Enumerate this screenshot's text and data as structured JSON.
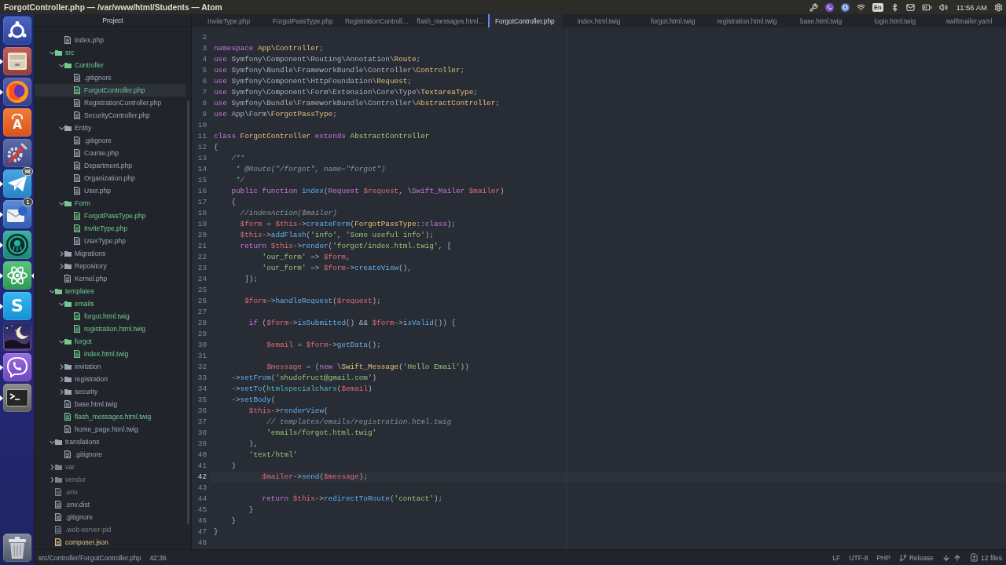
{
  "window": {
    "title": "ForgotController.php — /var/www/html/Students — Atom"
  },
  "top_bar": {
    "keyboard_layout": "En",
    "clock": "11:56 AM"
  },
  "launcher": {
    "items": [
      {
        "kind": "dash",
        "running": false,
        "focused": false
      },
      {
        "kind": "files",
        "running": true,
        "focused": false
      },
      {
        "kind": "browser",
        "running": true,
        "focused": false
      },
      {
        "kind": "store",
        "glyph": "A",
        "running": false,
        "focused": false
      },
      {
        "kind": "tools",
        "running": false,
        "focused": false
      },
      {
        "kind": "messenger",
        "badge": "98",
        "running": true,
        "focused": false
      },
      {
        "kind": "mail",
        "badge": "1",
        "running": true,
        "focused": false
      },
      {
        "kind": "octopus",
        "running": true,
        "focused": false
      },
      {
        "kind": "atom",
        "running": true,
        "focused": true
      },
      {
        "kind": "chat",
        "glyph": "S",
        "running": true,
        "focused": false
      },
      {
        "kind": "night",
        "running": false,
        "focused": false
      },
      {
        "kind": "phone",
        "running": true,
        "focused": false
      },
      {
        "kind": "terminal",
        "running": true,
        "focused": false
      }
    ],
    "bottom_items": [
      {
        "kind": "trash",
        "running": false,
        "focused": false
      }
    ]
  },
  "tree": {
    "header": "Project",
    "continued_items": [
      {
        "kind": "file",
        "name": "index.php",
        "color": "#9da5b4",
        "selected": false
      }
    ],
    "items": [
      {
        "kind": "folder",
        "name": "src",
        "color": "#73c990",
        "expanded": true,
        "selected": false,
        "children": [
          {
            "kind": "folder",
            "name": "Controller",
            "color": "#73c990",
            "expanded": true,
            "selected": false,
            "children": [
              {
                "kind": "file",
                "name": ".gitignore",
                "color": "#9da5b4",
                "selected": false
              },
              {
                "kind": "file",
                "name": "ForgotController.php",
                "color": "#73c990",
                "selected": true
              },
              {
                "kind": "file",
                "name": "RegistrationController.php",
                "color": "#9da5b4",
                "selected": false
              },
              {
                "kind": "file",
                "name": "SecurityController.php",
                "color": "#9da5b4",
                "selected": false
              }
            ]
          },
          {
            "kind": "folder",
            "name": "Entity",
            "color": "#9da5b4",
            "expanded": true,
            "selected": false,
            "children": [
              {
                "kind": "file",
                "name": ".gitignore",
                "color": "#9da5b4",
                "selected": false
              },
              {
                "kind": "file",
                "name": "Course.php",
                "color": "#9da5b4",
                "selected": false
              },
              {
                "kind": "file",
                "name": "Department.php",
                "color": "#9da5b4",
                "selected": false
              },
              {
                "kind": "file",
                "name": "Organization.php",
                "color": "#9da5b4",
                "selected": false
              },
              {
                "kind": "file",
                "name": "User.php",
                "color": "#9da5b4",
                "selected": false
              }
            ]
          },
          {
            "kind": "folder",
            "name": "Form",
            "color": "#73c990",
            "expanded": true,
            "selected": false,
            "children": [
              {
                "kind": "file",
                "name": "ForgotPassType.php",
                "color": "#73c990",
                "selected": false
              },
              {
                "kind": "file",
                "name": "InviteType.php",
                "color": "#73c990",
                "selected": false
              },
              {
                "kind": "file",
                "name": "UserType.php",
                "color": "#9da5b4",
                "selected": false
              }
            ]
          },
          {
            "kind": "folder",
            "name": "Migrations",
            "color": "#9da5b4",
            "expanded": false,
            "selected": false
          },
          {
            "kind": "folder",
            "name": "Repository",
            "color": "#9da5b4",
            "expanded": false,
            "selected": false
          },
          {
            "kind": "file",
            "name": "Kernel.php",
            "color": "#9da5b4",
            "selected": false
          }
        ]
      },
      {
        "kind": "folder",
        "name": "templates",
        "color": "#73c990",
        "expanded": true,
        "selected": false,
        "children": [
          {
            "kind": "folder",
            "name": "emails",
            "color": "#73c990",
            "expanded": true,
            "selected": false,
            "children": [
              {
                "kind": "file",
                "name": "forgot.html.twig",
                "color": "#73c990",
                "selected": false
              },
              {
                "kind": "file",
                "name": "registration.html.twig",
                "color": "#73c990",
                "selected": false
              }
            ]
          },
          {
            "kind": "folder",
            "name": "forgot",
            "color": "#73c990",
            "expanded": true,
            "selected": false,
            "children": [
              {
                "kind": "file",
                "name": "index.html.twig",
                "color": "#73c990",
                "selected": false
              }
            ]
          },
          {
            "kind": "folder",
            "name": "invitation",
            "color": "#9da5b4",
            "expanded": false,
            "selected": false
          },
          {
            "kind": "folder",
            "name": "registration",
            "color": "#9da5b4",
            "expanded": false,
            "selected": false
          },
          {
            "kind": "folder",
            "name": "security",
            "color": "#9da5b4",
            "expanded": false,
            "selected": false
          },
          {
            "kind": "file",
            "name": "base.html.twig",
            "color": "#9da5b4",
            "selected": false
          },
          {
            "kind": "file",
            "name": "flash_messages.html.twig",
            "color": "#73c990",
            "selected": false
          },
          {
            "kind": "file",
            "name": "home_page.html.twig",
            "color": "#9da5b4",
            "selected": false
          }
        ]
      },
      {
        "kind": "folder",
        "name": "translations",
        "color": "#9da5b4",
        "expanded": true,
        "selected": false,
        "children": [
          {
            "kind": "file",
            "name": ".gitignore",
            "color": "#9da5b4",
            "selected": false
          }
        ]
      },
      {
        "kind": "folder",
        "name": "var",
        "color": "#7a808c",
        "expanded": false,
        "selected": false
      },
      {
        "kind": "folder",
        "name": "vendor",
        "color": "#7a808c",
        "expanded": false,
        "selected": false
      },
      {
        "kind": "file",
        "name": ".env",
        "color": "#7a808c",
        "selected": false
      },
      {
        "kind": "file",
        "name": ".env.dist",
        "color": "#9da5b4",
        "selected": false
      },
      {
        "kind": "file",
        "name": ".gitignore",
        "color": "#9da5b4",
        "selected": false
      },
      {
        "kind": "file",
        "name": ".web-server-pid",
        "color": "#7a808c",
        "selected": false
      },
      {
        "kind": "file",
        "name": "composer.json",
        "color": "#e2c08d",
        "selected": false
      }
    ]
  },
  "tabs": [
    {
      "label": "InviteType.php",
      "selected": false
    },
    {
      "label": "ForgotPassType.php",
      "selected": false
    },
    {
      "label": "RegistrationControll…",
      "selected": false
    },
    {
      "label": "flash_messages.html…",
      "selected": false
    },
    {
      "label": "ForgotController.php",
      "selected": true
    },
    {
      "label": "index.html.twig",
      "selected": false
    },
    {
      "label": "forgot.html.twig",
      "selected": false
    },
    {
      "label": "registration.html.twig",
      "selected": false
    },
    {
      "label": "base.html.twig",
      "selected": false
    },
    {
      "label": "login.html.twig",
      "selected": false
    },
    {
      "label": "swiftmailer.yaml",
      "selected": false
    }
  ],
  "editor": {
    "lines": [
      {
        "number": "2",
        "current": false
      },
      {
        "number": "3",
        "current": false,
        "tokens": [
          {
            "kind": "keyword",
            "text": "namespace "
          },
          {
            "kind": "type",
            "text": "App\\Controller"
          },
          {
            "kind": "plain",
            "text": ";"
          }
        ]
      },
      {
        "number": "4",
        "current": false,
        "tokens": [
          {
            "kind": "keyword",
            "text": "use "
          },
          {
            "kind": "plain",
            "text": "Symfony\\Component\\Routing\\Annotation\\"
          },
          {
            "kind": "type",
            "text": "Route"
          },
          {
            "kind": "plain",
            "text": ";"
          }
        ]
      },
      {
        "number": "5",
        "current": false,
        "tokens": [
          {
            "kind": "keyword",
            "text": "use "
          },
          {
            "kind": "plain",
            "text": "Symfony\\Bundle\\FrameworkBundle\\Controller\\"
          },
          {
            "kind": "type",
            "text": "Controller"
          },
          {
            "kind": "plain",
            "text": ";"
          }
        ]
      },
      {
        "number": "6",
        "current": false,
        "tokens": [
          {
            "kind": "keyword",
            "text": "use "
          },
          {
            "kind": "plain",
            "text": "Symfony\\Component\\HttpFoundation\\"
          },
          {
            "kind": "type",
            "text": "Request"
          },
          {
            "kind": "plain",
            "text": ";"
          }
        ]
      },
      {
        "number": "7",
        "current": false,
        "tokens": [
          {
            "kind": "keyword",
            "text": "use "
          },
          {
            "kind": "plain",
            "text": "Symfony\\Component\\Form\\Extension\\Core\\Type\\"
          },
          {
            "kind": "type",
            "text": "TextareaType"
          },
          {
            "kind": "plain",
            "text": ";"
          }
        ]
      },
      {
        "number": "8",
        "current": false,
        "tokens": [
          {
            "kind": "keyword",
            "text": "use "
          },
          {
            "kind": "plain",
            "text": "Symfony\\Bundle\\FrameworkBundle\\Controller\\"
          },
          {
            "kind": "type",
            "text": "AbstractController"
          },
          {
            "kind": "plain",
            "text": ";"
          }
        ]
      },
      {
        "number": "9",
        "current": false,
        "tokens": [
          {
            "kind": "keyword",
            "text": "use "
          },
          {
            "kind": "plain",
            "text": "App\\Form\\"
          },
          {
            "kind": "type",
            "text": "ForgotPassType"
          },
          {
            "kind": "plain",
            "text": ";"
          }
        ]
      },
      {
        "number": "10",
        "current": false
      },
      {
        "number": "11",
        "current": false,
        "tokens": [
          {
            "kind": "keyword",
            "text": "class "
          },
          {
            "kind": "type",
            "text": "ForgotController"
          },
          {
            "kind": "keyword",
            "text": " extends "
          },
          {
            "kind": "inherited",
            "text": "AbstractController"
          }
        ]
      },
      {
        "number": "12",
        "current": false,
        "tokens": [
          {
            "kind": "plain",
            "text": "{"
          }
        ]
      },
      {
        "number": "13",
        "current": false,
        "tokens": [
          {
            "kind": "comment",
            "text": "    /**"
          }
        ]
      },
      {
        "number": "14",
        "current": false,
        "tokens": [
          {
            "kind": "comment",
            "text": "     * @Route(\"/forgot\", name=\"forgot\")"
          }
        ]
      },
      {
        "number": "15",
        "current": false,
        "tokens": [
          {
            "kind": "comment",
            "text": "     */"
          }
        ]
      },
      {
        "number": "16",
        "current": false,
        "tokens": [
          {
            "kind": "keyword",
            "text": "    public function "
          },
          {
            "kind": "function",
            "text": "index"
          },
          {
            "kind": "plain",
            "text": "("
          },
          {
            "kind": "keyword",
            "text": "Request "
          },
          {
            "kind": "variable",
            "text": "$request"
          },
          {
            "kind": "plain",
            "text": ", \\"
          },
          {
            "kind": "keyword",
            "text": "Swift_Mailer "
          },
          {
            "kind": "variable",
            "text": "$mailer"
          },
          {
            "kind": "plain",
            "text": ")"
          }
        ]
      },
      {
        "number": "17",
        "current": false,
        "tokens": [
          {
            "kind": "plain",
            "text": "    {"
          }
        ]
      },
      {
        "number": "18",
        "current": false,
        "tokens": [
          {
            "kind": "comment",
            "text": "      //indexAction($mailer)"
          }
        ]
      },
      {
        "number": "19",
        "current": false,
        "tokens": [
          {
            "kind": "variable",
            "text": "      $form"
          },
          {
            "kind": "plain",
            "text": " = "
          },
          {
            "kind": "variable",
            "text": "$this"
          },
          {
            "kind": "plain",
            "text": "->"
          },
          {
            "kind": "function",
            "text": "createForm"
          },
          {
            "kind": "plain",
            "text": "("
          },
          {
            "kind": "type",
            "text": "ForgotPassType"
          },
          {
            "kind": "plain",
            "text": "::"
          },
          {
            "kind": "keyword",
            "text": "class"
          },
          {
            "kind": "plain",
            "text": ");"
          }
        ]
      },
      {
        "number": "20",
        "current": false,
        "tokens": [
          {
            "kind": "variable",
            "text": "      $this"
          },
          {
            "kind": "plain",
            "text": "->"
          },
          {
            "kind": "function",
            "text": "addFlash"
          },
          {
            "kind": "plain",
            "text": "("
          },
          {
            "kind": "string",
            "text": "'info'"
          },
          {
            "kind": "plain",
            "text": ", "
          },
          {
            "kind": "string",
            "text": "'Some useful info'"
          },
          {
            "kind": "plain",
            "text": ");"
          }
        ]
      },
      {
        "number": "21",
        "current": false,
        "tokens": [
          {
            "kind": "keyword",
            "text": "      return "
          },
          {
            "kind": "variable",
            "text": "$this"
          },
          {
            "kind": "plain",
            "text": "->"
          },
          {
            "kind": "function",
            "text": "render"
          },
          {
            "kind": "plain",
            "text": "("
          },
          {
            "kind": "string",
            "text": "'forgot/index.html.twig'"
          },
          {
            "kind": "plain",
            "text": ", ["
          }
        ]
      },
      {
        "number": "22",
        "current": false,
        "tokens": [
          {
            "kind": "string",
            "text": "           'our_form'"
          },
          {
            "kind": "plain",
            "text": " => "
          },
          {
            "kind": "variable",
            "text": "$form"
          },
          {
            "kind": "plain",
            "text": ","
          }
        ]
      },
      {
        "number": "23",
        "current": false,
        "tokens": [
          {
            "kind": "string",
            "text": "           'our_form'"
          },
          {
            "kind": "plain",
            "text": " => "
          },
          {
            "kind": "variable",
            "text": "$form"
          },
          {
            "kind": "plain",
            "text": "->"
          },
          {
            "kind": "function",
            "text": "createView"
          },
          {
            "kind": "plain",
            "text": "(),"
          }
        ]
      },
      {
        "number": "24",
        "current": false,
        "tokens": [
          {
            "kind": "plain",
            "text": "       ]);"
          }
        ]
      },
      {
        "number": "25",
        "current": false
      },
      {
        "number": "26",
        "current": false,
        "tokens": [
          {
            "kind": "variable",
            "text": "       $form"
          },
          {
            "kind": "plain",
            "text": "->"
          },
          {
            "kind": "function",
            "text": "handleRequest"
          },
          {
            "kind": "plain",
            "text": "("
          },
          {
            "kind": "variable",
            "text": "$request"
          },
          {
            "kind": "plain",
            "text": ");"
          }
        ]
      },
      {
        "number": "27",
        "current": false
      },
      {
        "number": "28",
        "current": false,
        "tokens": [
          {
            "kind": "keyword",
            "text": "        if"
          },
          {
            "kind": "plain",
            "text": " ("
          },
          {
            "kind": "variable",
            "text": "$form"
          },
          {
            "kind": "plain",
            "text": "->"
          },
          {
            "kind": "function",
            "text": "isSubmitted"
          },
          {
            "kind": "plain",
            "text": "() && "
          },
          {
            "kind": "variable",
            "text": "$form"
          },
          {
            "kind": "plain",
            "text": "->"
          },
          {
            "kind": "function",
            "text": "isValid"
          },
          {
            "kind": "plain",
            "text": "()) {"
          }
        ]
      },
      {
        "number": "29",
        "current": false
      },
      {
        "number": "30",
        "current": false,
        "tokens": [
          {
            "kind": "variable",
            "text": "            $email"
          },
          {
            "kind": "plain",
            "text": " = "
          },
          {
            "kind": "variable",
            "text": "$form"
          },
          {
            "kind": "plain",
            "text": "->"
          },
          {
            "kind": "function",
            "text": "getData"
          },
          {
            "kind": "plain",
            "text": "();"
          }
        ]
      },
      {
        "number": "31",
        "current": false
      },
      {
        "number": "32",
        "current": false,
        "tokens": [
          {
            "kind": "variable",
            "text": "            $message"
          },
          {
            "kind": "plain",
            "text": " = ("
          },
          {
            "kind": "keyword",
            "text": "new"
          },
          {
            "kind": "plain",
            "text": " \\"
          },
          {
            "kind": "type",
            "text": "Swift_Message"
          },
          {
            "kind": "plain",
            "text": "("
          },
          {
            "kind": "string",
            "text": "'Hello Email'"
          },
          {
            "kind": "plain",
            "text": "))"
          }
        ]
      },
      {
        "number": "33",
        "current": false,
        "tokens": [
          {
            "kind": "plain",
            "text": "    ->"
          },
          {
            "kind": "function",
            "text": "setFrom"
          },
          {
            "kind": "plain",
            "text": "("
          },
          {
            "kind": "string",
            "text": "'shudofruct@gmail.com'"
          },
          {
            "kind": "plain",
            "text": ")"
          }
        ]
      },
      {
        "number": "34",
        "current": false,
        "tokens": [
          {
            "kind": "plain",
            "text": "    ->"
          },
          {
            "kind": "function",
            "text": "setTo"
          },
          {
            "kind": "plain",
            "text": "("
          },
          {
            "kind": "builtin",
            "text": "htmlspecialchars"
          },
          {
            "kind": "plain",
            "text": "("
          },
          {
            "kind": "variable",
            "text": "$email"
          },
          {
            "kind": "plain",
            "text": ")"
          }
        ]
      },
      {
        "number": "35",
        "current": false,
        "tokens": [
          {
            "kind": "plain",
            "text": "    ->"
          },
          {
            "kind": "function",
            "text": "setBody"
          },
          {
            "kind": "plain",
            "text": "("
          }
        ]
      },
      {
        "number": "36",
        "current": false,
        "tokens": [
          {
            "kind": "variable",
            "text": "        $this"
          },
          {
            "kind": "plain",
            "text": "->"
          },
          {
            "kind": "function",
            "text": "renderView"
          },
          {
            "kind": "plain",
            "text": "("
          }
        ]
      },
      {
        "number": "37",
        "current": false,
        "tokens": [
          {
            "kind": "comment",
            "text": "            // templates/emails/registration.html.twig"
          }
        ]
      },
      {
        "number": "38",
        "current": false,
        "tokens": [
          {
            "kind": "string",
            "text": "            'emails/forgot.html.twig'"
          }
        ]
      },
      {
        "number": "39",
        "current": false,
        "tokens": [
          {
            "kind": "plain",
            "text": "        ),"
          }
        ]
      },
      {
        "number": "40",
        "current": false,
        "tokens": [
          {
            "kind": "string",
            "text": "        'text/html'"
          }
        ]
      },
      {
        "number": "41",
        "current": false,
        "tokens": [
          {
            "kind": "plain",
            "text": "    )"
          }
        ]
      },
      {
        "number": "42",
        "current": true,
        "tokens": [
          {
            "kind": "variable",
            "text": "           $mailer"
          },
          {
            "kind": "plain",
            "text": "->"
          },
          {
            "kind": "function",
            "text": "send"
          },
          {
            "kind": "plain",
            "text": "("
          },
          {
            "kind": "variable",
            "text": "$message"
          },
          {
            "kind": "plain",
            "text": ");"
          }
        ]
      },
      {
        "number": "43",
        "current": false
      },
      {
        "number": "44",
        "current": false,
        "tokens": [
          {
            "kind": "keyword",
            "text": "           return "
          },
          {
            "kind": "variable",
            "text": "$this"
          },
          {
            "kind": "plain",
            "text": "->"
          },
          {
            "kind": "function",
            "text": "redirectToRoute"
          },
          {
            "kind": "plain",
            "text": "("
          },
          {
            "kind": "string",
            "text": "'contact'"
          },
          {
            "kind": "plain",
            "text": ");"
          }
        ]
      },
      {
        "number": "45",
        "current": false,
        "tokens": [
          {
            "kind": "plain",
            "text": "        }"
          }
        ]
      },
      {
        "number": "46",
        "current": false,
        "tokens": [
          {
            "kind": "plain",
            "text": "    }"
          }
        ]
      },
      {
        "number": "47",
        "current": false,
        "tokens": [
          {
            "kind": "plain",
            "text": "}"
          }
        ]
      },
      {
        "number": "48",
        "current": false
      }
    ]
  },
  "status_bar": {
    "file_path": "src/Controller/ForgotController.php",
    "cursor": "42:36",
    "line_ending": "LF",
    "encoding": "UTF-8",
    "grammar": "PHP",
    "branch": "Release",
    "changed_files": "12 files"
  }
}
